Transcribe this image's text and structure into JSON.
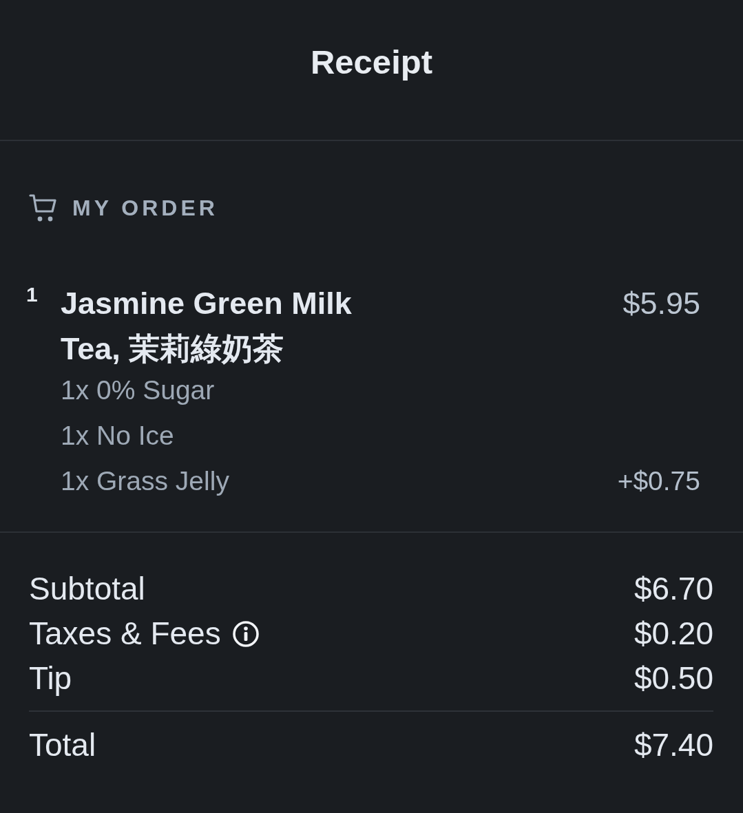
{
  "header": {
    "title": "Receipt"
  },
  "order": {
    "heading": "MY ORDER",
    "items": [
      {
        "quantity": "1",
        "name": "Jasmine Green Milk Tea, 茉莉綠奶茶",
        "price": "$5.95",
        "modifiers": [
          {
            "label": "1x 0% Sugar"
          },
          {
            "label": "1x No Ice"
          },
          {
            "label": "1x Grass Jelly",
            "price": "+$0.75"
          }
        ]
      }
    ]
  },
  "totals": {
    "rows": [
      {
        "label": "Subtotal",
        "value": "$6.70",
        "info": false
      },
      {
        "label": "Taxes & Fees",
        "value": "$0.20",
        "info": true
      },
      {
        "label": "Tip",
        "value": "$0.50",
        "info": false
      }
    ],
    "total": {
      "label": "Total",
      "value": "$7.40"
    }
  }
}
